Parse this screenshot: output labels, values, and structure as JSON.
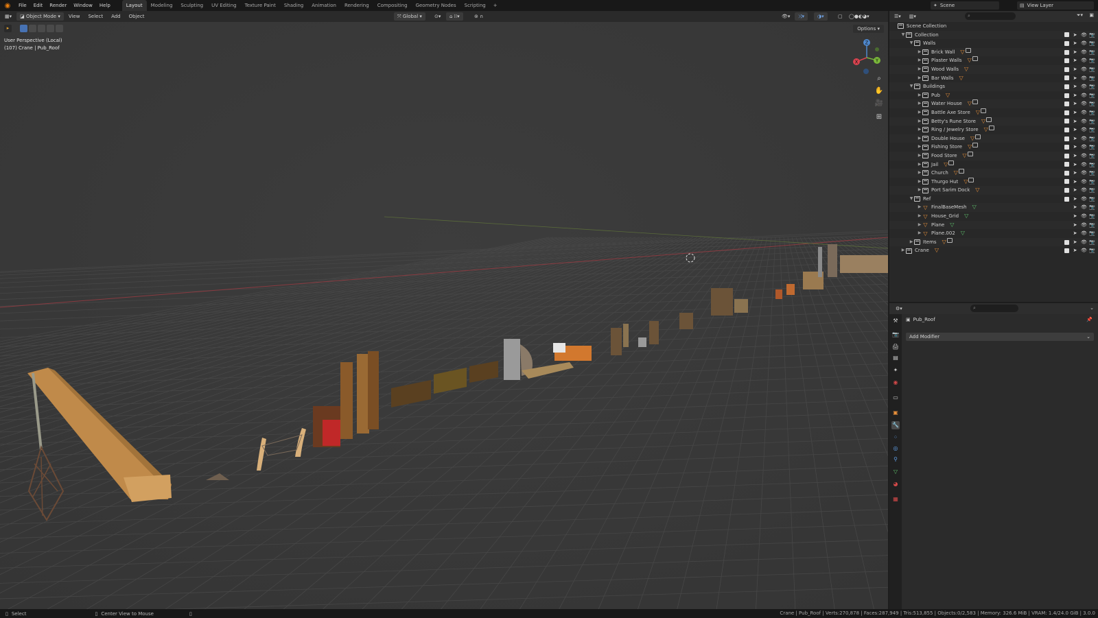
{
  "menubar": {
    "items": [
      "File",
      "Edit",
      "Render",
      "Window",
      "Help"
    ],
    "workspaces": [
      "Layout",
      "Modeling",
      "Sculpting",
      "UV Editing",
      "Texture Paint",
      "Shading",
      "Animation",
      "Rendering",
      "Compositing",
      "Geometry Nodes",
      "Scripting"
    ],
    "active_workspace": "Layout",
    "add_tab": "+",
    "scene": "Scene",
    "view_layer": "View Layer"
  },
  "viewport": {
    "mode": "Object Mode",
    "menus": [
      "View",
      "Select",
      "Add",
      "Object"
    ],
    "transform_orientation": "Global",
    "options": "Options",
    "perspective": "User Perspective (Local)",
    "active_object": "(107) Crane | Pub_Roof",
    "gizmo_axes": [
      "Z",
      "Y",
      "X"
    ]
  },
  "outliner": {
    "root": "Scene Collection",
    "rows": [
      {
        "label": "Collection",
        "depth": 1,
        "kind": "collection",
        "open": true,
        "badges": []
      },
      {
        "label": "Walls",
        "depth": 2,
        "kind": "collection",
        "open": true,
        "badges": []
      },
      {
        "label": "Brick Wall",
        "depth": 3,
        "kind": "collection",
        "open": false,
        "badges": [
          "mesh",
          "data"
        ]
      },
      {
        "label": "Plaster Walls",
        "depth": 3,
        "kind": "collection",
        "open": false,
        "badges": [
          "mesh",
          "data"
        ]
      },
      {
        "label": "Wood Walls",
        "depth": 3,
        "kind": "collection",
        "open": false,
        "badges": [
          "mesh"
        ]
      },
      {
        "label": "Bar Walls",
        "depth": 3,
        "kind": "collection",
        "open": false,
        "badges": [
          "mesh"
        ]
      },
      {
        "label": "Buildings",
        "depth": 2,
        "kind": "collection",
        "open": true,
        "badges": []
      },
      {
        "label": "Pub",
        "depth": 3,
        "kind": "collection",
        "open": false,
        "badges": [
          "mesh"
        ]
      },
      {
        "label": "Water House",
        "depth": 3,
        "kind": "collection",
        "open": false,
        "badges": [
          "mesh",
          "data"
        ]
      },
      {
        "label": "Battle Axe Store",
        "depth": 3,
        "kind": "collection",
        "open": false,
        "badges": [
          "mesh",
          "data"
        ]
      },
      {
        "label": "Betty's Rune Store",
        "depth": 3,
        "kind": "collection",
        "open": false,
        "badges": [
          "mesh",
          "data"
        ]
      },
      {
        "label": "Ring / Jewelry Store",
        "depth": 3,
        "kind": "collection",
        "open": false,
        "badges": [
          "mesh",
          "data"
        ]
      },
      {
        "label": "Double House",
        "depth": 3,
        "kind": "collection",
        "open": false,
        "badges": [
          "mesh",
          "data"
        ]
      },
      {
        "label": "Fishing Store",
        "depth": 3,
        "kind": "collection",
        "open": false,
        "badges": [
          "mesh",
          "data"
        ]
      },
      {
        "label": "Food Store",
        "depth": 3,
        "kind": "collection",
        "open": false,
        "badges": [
          "mesh",
          "data"
        ]
      },
      {
        "label": "Jail",
        "depth": 3,
        "kind": "collection",
        "open": false,
        "badges": [
          "mesh",
          "data"
        ]
      },
      {
        "label": "Church",
        "depth": 3,
        "kind": "collection",
        "open": false,
        "badges": [
          "mesh",
          "data"
        ]
      },
      {
        "label": "Thurgo Hut",
        "depth": 3,
        "kind": "collection",
        "open": false,
        "badges": [
          "mesh",
          "data"
        ]
      },
      {
        "label": "Port Sarim Dock",
        "depth": 3,
        "kind": "collection",
        "open": false,
        "badges": [
          "mesh"
        ]
      },
      {
        "label": "Ref",
        "depth": 2,
        "kind": "collection",
        "open": true,
        "badges": []
      },
      {
        "label": "FinalBaseMesh",
        "depth": 3,
        "kind": "object",
        "open": false,
        "badges": [
          "green"
        ]
      },
      {
        "label": "House_Grid",
        "depth": 3,
        "kind": "object",
        "open": false,
        "badges": [
          "green"
        ]
      },
      {
        "label": "Plane",
        "depth": 3,
        "kind": "object",
        "open": false,
        "badges": [
          "green"
        ]
      },
      {
        "label": "Plane.002",
        "depth": 3,
        "kind": "object",
        "open": false,
        "badges": [
          "green"
        ]
      },
      {
        "label": "Items",
        "depth": 2,
        "kind": "collection",
        "open": false,
        "badges": [
          "mesh",
          "data"
        ]
      },
      {
        "label": "Crane",
        "depth": 1,
        "kind": "collection",
        "open": false,
        "badges": [
          "mesh"
        ]
      }
    ]
  },
  "properties": {
    "object_name": "Pub_Roof",
    "add_modifier": "Add Modifier"
  },
  "statusbar": {
    "select": "Select",
    "center_view": "Center View to Mouse",
    "stats": "Crane | Pub_Roof | Verts:270,878 | Faces:287,949 | Tris:513,855 | Objects:0/2,583 | Memory: 326.6 MiB | VRAM: 1.4/24.0 GiB | 3.0.0"
  },
  "colors": {
    "accent": "#4772b3",
    "object_orange": "#e8903a",
    "mesh_green": "#5ec06b",
    "axis_x": "#d9434f",
    "axis_y": "#7ab83a",
    "axis_z": "#4f89cf"
  },
  "icons": [
    "blender-logo-icon",
    "editor-type-icon",
    "search-icon",
    "filter-icon",
    "eye-icon",
    "camera-icon",
    "pointer-icon",
    "checkbox-icon",
    "zoom-icon",
    "hand-icon",
    "camera-view-icon",
    "grid-icon",
    "wrench-icon",
    "pin-icon"
  ]
}
